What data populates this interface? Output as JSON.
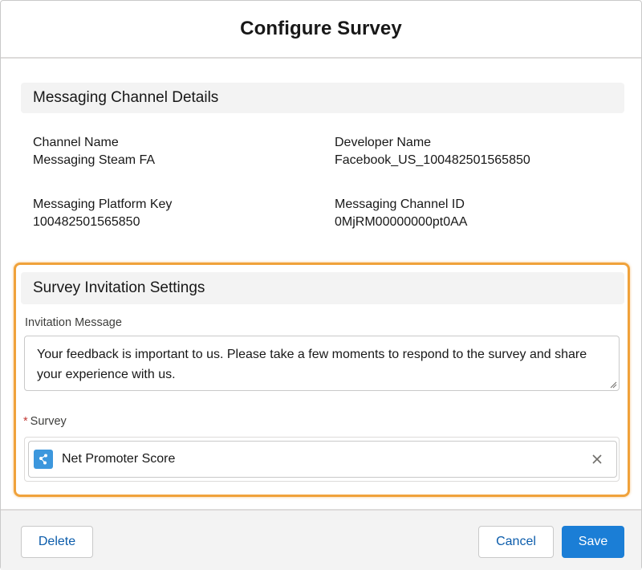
{
  "modal": {
    "title": "Configure Survey"
  },
  "channel_section": {
    "heading": "Messaging Channel Details",
    "fields": [
      {
        "label": "Channel Name",
        "value": "Messaging Steam FA"
      },
      {
        "label": "Developer Name",
        "value": "Facebook_US_100482501565850"
      },
      {
        "label": "Messaging Platform Key",
        "value": "100482501565850"
      },
      {
        "label": "Messaging Channel ID",
        "value": "0MjRM00000000pt0AA"
      }
    ]
  },
  "survey_section": {
    "heading": "Survey Invitation Settings",
    "invitation_label": "Invitation Message",
    "invitation_message": "Your feedback is important to us. Please take a few moments to respond to the survey and share your experience with us.",
    "survey_required_marker": "*",
    "survey_label": "Survey",
    "survey_value": "Net Promoter Score",
    "survey_icon": "survey-icon",
    "clear_icon": "close-icon",
    "highlight_color": "#f0a23b"
  },
  "footer": {
    "delete_label": "Delete",
    "cancel_label": "Cancel",
    "save_label": "Save",
    "brand_color": "#1b7ed6"
  }
}
